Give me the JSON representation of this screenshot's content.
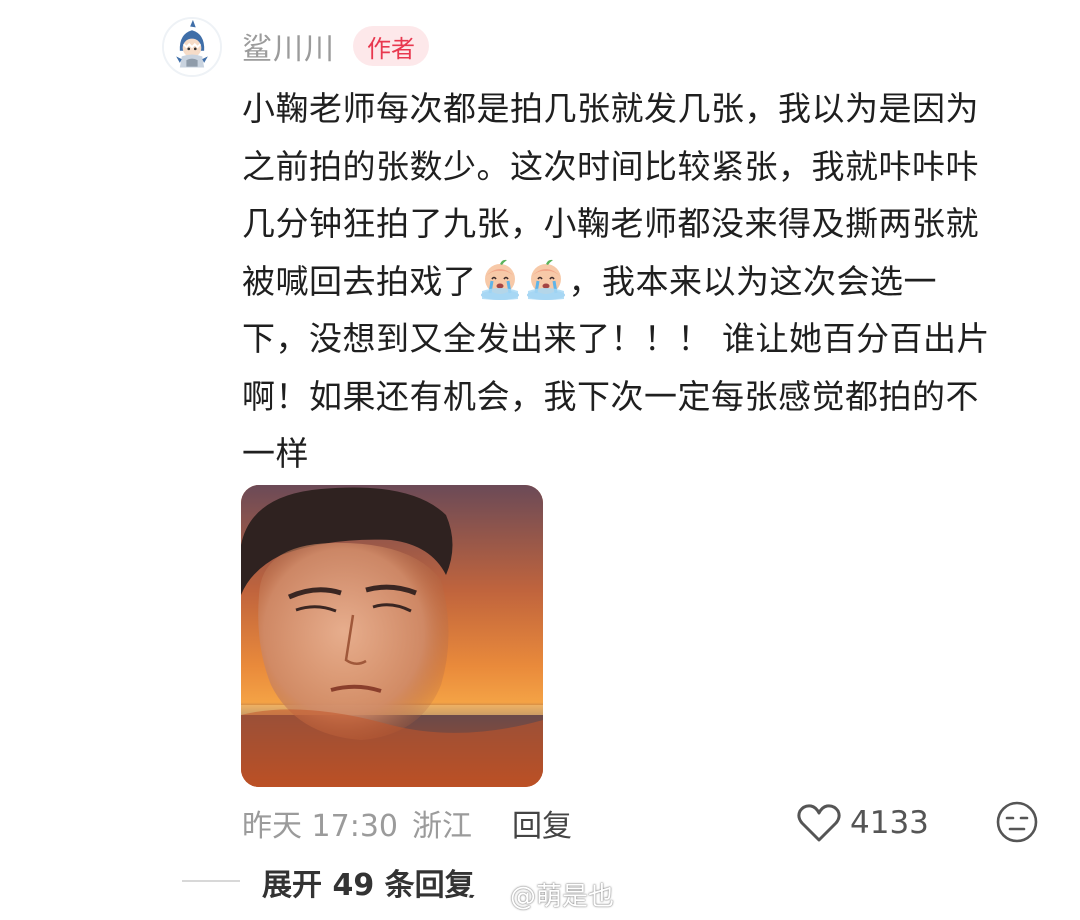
{
  "comment": {
    "username": "鲨川川",
    "badge": "作者",
    "text_lines": [
      "小鞠老师每次都是拍几张就发几张，我以为是因为",
      "之前拍的张数少。这次时间比较紧张，我就咔咔咔",
      "几分钟狂拍了九张，小鞠老师都没来得及撕两张就"
    ],
    "line4_before": "被喊回去拍戏了",
    "line4_after": "，我本来以为这次会选一",
    "text_lines_tail": [
      "下，没想到又全发出来了！！！ 谁让她百分百出片",
      "啊！如果还有机会，我下次一定每张感觉都拍的不",
      "一样"
    ],
    "inline_emoji": [
      "crying-face-emoji",
      "crying-face-emoji"
    ],
    "image_icon": "crying-man-sunset-photo",
    "timestamp": "昨天 17:30",
    "location": "浙江",
    "reply_label": "回复",
    "like_icon": "heart-outline-icon",
    "likes": "4133",
    "reaction_icon": "meh-face-icon"
  },
  "replies": {
    "expand_label": "展开 49 条回复"
  },
  "watermark": {
    "icon": "weibo-logo",
    "text": "@萌是也"
  }
}
